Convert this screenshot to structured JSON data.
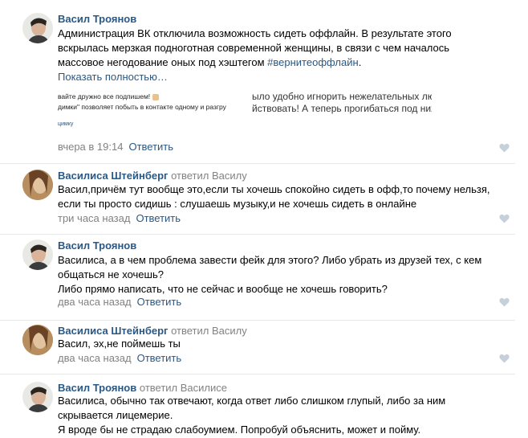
{
  "colors": {
    "link": "#2a5885",
    "muted": "#828282",
    "divider": "#e7e8ec",
    "heart": "#c5d0db"
  },
  "comments": [
    {
      "author": "Васил Троянов",
      "reply_to": "",
      "lines": [
        "Администрация ВК отключила возможность сидеть оффлайн. В результате этого",
        "вскрылась мерзкая подноготная современной женщины, в связи с чем началось",
        "массовое негодование оных под хэштегом "
      ],
      "hashtag": "#вернитеоффлайн",
      "hashtag_suffix": ".",
      "show_more": "Показать полностью…",
      "snippet": {
        "left1": "вайте дружно все подпишем!",
        "left2": "димки\" позволяет побыть в контакте одному и разгру",
        "left3": "цимку",
        "right1": "ыло удобно игнорить нежелательных людей",
        "right2": "йствовать! А теперь прогибаться под них!? ,"
      },
      "time": "вчера в 19:14",
      "reply_label": "Ответить"
    },
    {
      "author": "Василиса Штейнберг",
      "reply_prefix": "ответил",
      "reply_to": "Василу",
      "lines": [
        "Васил,причём тут вообще это,если ты хочешь спокойно сидеть в офф,то почему нельзя,",
        "если ты просто сидишь : слушаешь музыку,и не хочешь сидеть в онлайне"
      ],
      "time": "три часа назад",
      "reply_label": "Ответить"
    },
    {
      "author": "Васил Троянов",
      "reply_to": "",
      "lines": [
        "Василиса, а в чем проблема завести фейк для этого? Либо убрать из друзей тех, с кем",
        "общаться не хочешь?",
        "Либо прямо написать, что не сейчас и вообще не хочешь говорить?"
      ],
      "time": "два часа назад",
      "reply_label": "Ответить"
    },
    {
      "author": "Василиса Штейнберг",
      "reply_prefix": "ответил",
      "reply_to": "Василу",
      "lines": [
        "Васил, эх,не поймешь ты"
      ],
      "time": "два часа назад",
      "reply_label": "Ответить"
    },
    {
      "author": "Васил Троянов",
      "reply_prefix": "ответил",
      "reply_to": "Василисе",
      "lines": [
        "Василиса, обычно так отвечают, когда ответ либо слишком глупый, либо за ним",
        "скрывается лицемерие.",
        "Я вроде бы не страдаю слабоумием. Попробуй объяснить, может и пойму."
      ],
      "time": "",
      "reply_label": ""
    }
  ]
}
